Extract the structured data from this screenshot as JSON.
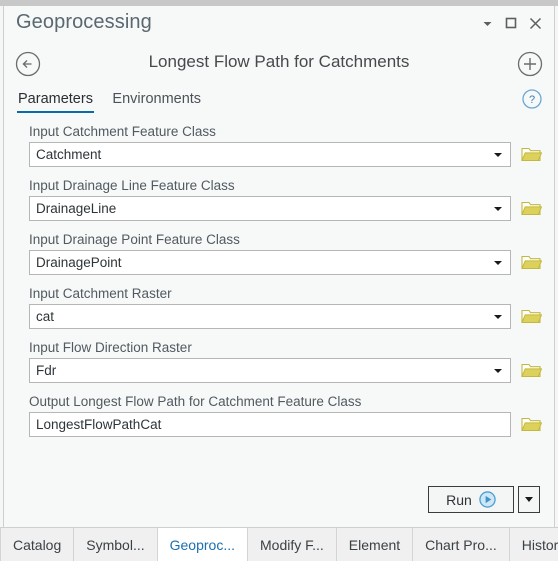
{
  "window": {
    "title": "Geoprocessing",
    "controls": [
      {
        "name": "menu-dropdown",
        "icon": "chevron-down-icon"
      },
      {
        "name": "maximize",
        "icon": "maximize-icon"
      },
      {
        "name": "close",
        "icon": "close-icon"
      }
    ]
  },
  "tool_header": {
    "back_icon": "back-arrow-circle-icon",
    "title": "Longest Flow Path for Catchments",
    "add_icon": "plus-circle-icon"
  },
  "tabs": {
    "items": [
      {
        "label": "Parameters",
        "active": true
      },
      {
        "label": "Environments",
        "active": false
      }
    ],
    "help_icon": "help-circle-icon"
  },
  "form": {
    "fields": [
      {
        "label": "Input Catchment Feature Class",
        "value": "Catchment",
        "placeholder": "",
        "dropdown": true,
        "browse": true,
        "browse_icon": "folder-open-icon"
      },
      {
        "label": "Input Drainage Line Feature Class",
        "value": "DrainageLine",
        "placeholder": "",
        "dropdown": true,
        "browse": true,
        "browse_icon": "folder-open-icon"
      },
      {
        "label": "Input Drainage Point Feature Class",
        "value": "DrainagePoint",
        "placeholder": "",
        "dropdown": true,
        "browse": true,
        "browse_icon": "folder-open-icon"
      },
      {
        "label": "Input Catchment Raster",
        "value": "cat",
        "placeholder": "",
        "dropdown": true,
        "browse": true,
        "browse_icon": "folder-open-icon"
      },
      {
        "label": "Input Flow Direction Raster",
        "value": "Fdr",
        "placeholder": "",
        "dropdown": true,
        "browse": true,
        "browse_icon": "folder-open-icon"
      },
      {
        "label": "Output Longest Flow Path for Catchment Feature Class",
        "value": "LongestFlowPathCat",
        "placeholder": "",
        "dropdown": false,
        "browse": true,
        "browse_icon": "folder-open-icon"
      }
    ]
  },
  "run": {
    "label": "Run",
    "icon": "run-play-circle-icon",
    "split_icon": "chevron-down-icon"
  },
  "bottom_tabs": [
    {
      "label": "Catalog",
      "active": false
    },
    {
      "label": "Symbol...",
      "active": false
    },
    {
      "label": "Geoproc...",
      "active": true
    },
    {
      "label": "Modify F...",
      "active": false
    },
    {
      "label": "Element",
      "active": false
    },
    {
      "label": "Chart Pro...",
      "active": false
    },
    {
      "label": "History",
      "active": false
    }
  ],
  "colors": {
    "accent_blue": "#0a6ca6",
    "active_tab_text": "#1a6fb0",
    "folder_yellow": "#d9ce52",
    "panel_bg": "#f7f8f8",
    "title_text": "#5a6872"
  }
}
